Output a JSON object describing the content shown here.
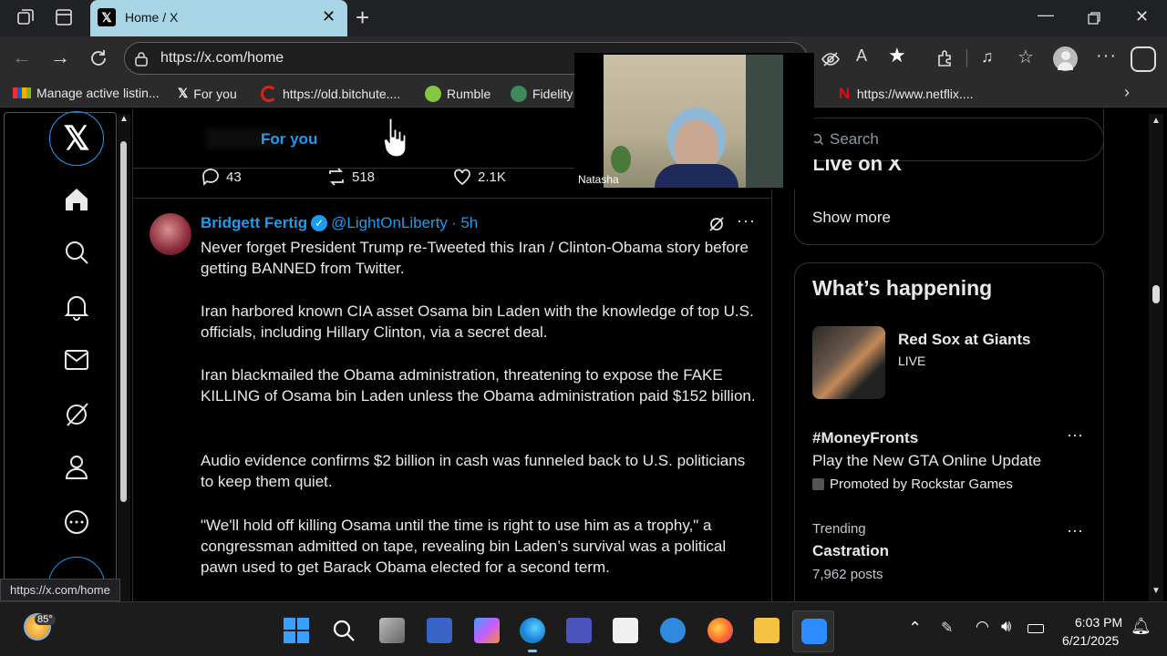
{
  "browser": {
    "tab_title": "Home / X",
    "url": "https://x.com/home",
    "status_url": "https://x.com/home",
    "bookmarks": [
      "Manage active listin...",
      "For you",
      "https://old.bitchute....",
      "Rumble",
      "Fidelity",
      "https://www.netflix...."
    ]
  },
  "x": {
    "tabs": {
      "for_you": "For you"
    },
    "stats": {
      "replies": "43",
      "reposts": "518",
      "likes": "2.1K"
    },
    "tweet": {
      "author": "Bridgett Fertig",
      "handle": "@LightOnLiberty",
      "time": "· 5h",
      "paragraphs": [
        "Never forget President Trump re-Tweeted this Iran / Clinton-Obama story before getting BANNED from Twitter.",
        "Iran harbored known CIA asset Osama bin Laden with the knowledge of top U.S. officials, including Hillary Clinton, via a secret deal.",
        "Iran blackmailed the Obama administration, threatening to expose the FAKE KILLING of Osama bin Laden unless the Obama administration paid $152 billion.",
        "Audio evidence confirms $2 billion in cash was funneled back to U.S. politicians to keep them quiet.",
        "\"We'll hold off killing Osama until the time is right to use him as a trophy,\" a congressman admitted on tape, revealing bin Laden’s survival was a political pawn used to get Barack Obama elected for a second term."
      ]
    },
    "search_placeholder": "Search",
    "live_heading_partial": "Live on X",
    "show_more": "Show more",
    "whats_happening": "What’s happening",
    "trends": [
      {
        "title": "Red Sox at Giants",
        "sub": "LIVE"
      },
      {
        "title": "#MoneyFronts",
        "desc": "Play the New GTA Online Update",
        "promo": "Promoted by Rockstar Games"
      },
      {
        "context": "Trending",
        "title": "Castration",
        "count": "7,962 posts"
      }
    ]
  },
  "video": {
    "name": "Natasha"
  },
  "taskbar": {
    "weather": "85°",
    "time": "6:03 PM",
    "date": "6/21/2025"
  },
  "colors": {
    "accent": "#1d9bf0",
    "tab": "#a8d5e6"
  }
}
